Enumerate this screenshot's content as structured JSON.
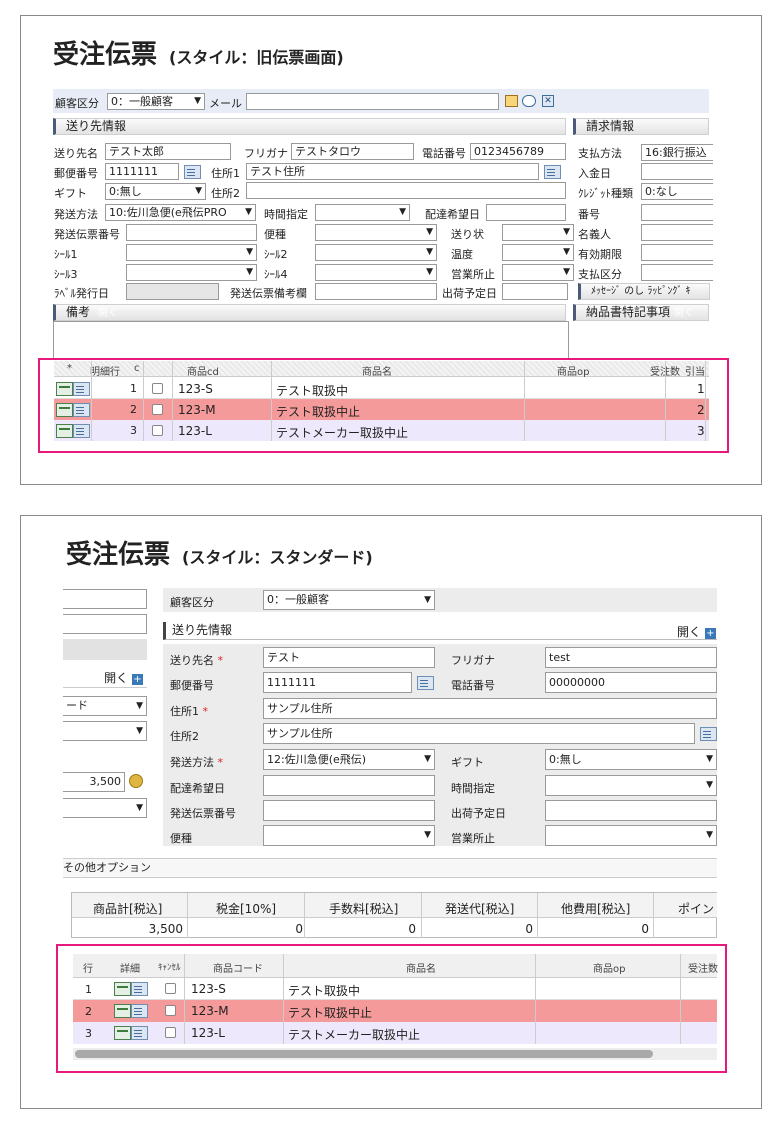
{
  "old": {
    "title": "受注伝票",
    "subtitle": "(スタイル：旧伝票画面)",
    "customer_type_label": "顧客区分",
    "customer_type_value": "0：一般顧客",
    "mail_label": "メール",
    "ship_section": "送り先情報",
    "bill_section": "請求情報",
    "ship_name_label": "送り先名",
    "ship_name_value": "テスト太郎",
    "kana_label": "フリガナ",
    "kana_value": "テストタロウ",
    "phone_label": "電話番号",
    "phone_value": "0123456789",
    "payment_label": "支払方法",
    "payment_value": "16:銀行振込",
    "zip_label": "郵便番号",
    "zip_value": "1111111",
    "addr1_label": "住所1",
    "addr1_value": "テスト住所",
    "deposit_label": "入金日",
    "gift_label": "ギフト",
    "gift_value": "0:無し",
    "addr2_label": "住所2",
    "credit_label": "ｸﾚｼﾞｯﾄ種類",
    "credit_value": "0:なし",
    "ship_method_label": "発送方法",
    "ship_method_value": "10:佐川急便(e飛伝PRO",
    "time_label": "時間指定",
    "delivery_date_label": "配達希望日",
    "number_label": "番号",
    "slip_no_label": "発送伝票番号",
    "flight_label": "便種",
    "invoice_label": "送り状",
    "holder_label": "名義人",
    "seal1_label": "ｼｰﾙ1",
    "seal2_label": "ｼｰﾙ2",
    "temp_label": "温度",
    "expiry_label": "有効期限",
    "seal3_label": "ｼｰﾙ3",
    "seal4_label": "ｼｰﾙ4",
    "office_label": "営業所止",
    "paytype_label": "支払区分",
    "label_date_label": "ﾗﾍﾞﾙ発行日",
    "slip_note_label": "発送伝票備考欄",
    "ship_date_label": "出荷予定日",
    "msg_tab": "ﾒｯｾｰｼﾞ のし ﾗｯﾋﾟﾝｸﾞ ｷ",
    "notes_section": "備考",
    "notes_toggle": "開く",
    "delivery_note_section": "納品書特記事項",
    "delivery_note_toggle": "開く",
    "cols": [
      "*",
      "明細行",
      "c",
      "商品cd",
      "商品名",
      "商品op",
      "受注数",
      "引当"
    ],
    "rows": [
      {
        "no": "1",
        "code": "123-S",
        "name": "テスト取扱中",
        "qty": "1"
      },
      {
        "no": "2",
        "code": "123-M",
        "name": "テスト取扱中止",
        "qty": "2"
      },
      {
        "no": "3",
        "code": "123-L",
        "name": "テストメーカー取扱中止",
        "qty": "3"
      }
    ]
  },
  "std": {
    "title": "受注伝票",
    "subtitle": "(スタイル：スタンダード)",
    "customer_type_label": "顧客区分",
    "customer_type_value": "0：一般顧客",
    "ship_section": "送り先情報",
    "open_label": "開く",
    "ship_name_label": "送り先名",
    "ship_name_value": "テスト",
    "kana_label": "フリガナ",
    "kana_value": "test",
    "zip_label": "郵便番号",
    "zip_value": "1111111",
    "phone_label": "電話番号",
    "phone_value": "00000000",
    "addr1_label": "住所1",
    "addr1_value": "サンプル住所",
    "addr2_label": "住所2",
    "addr2_value": "サンプル住所",
    "ship_method_label": "発送方法",
    "ship_method_value": "12:佐川急便(e飛伝)",
    "gift_label": "ギフト",
    "gift_value": "0:無し",
    "delivery_date_label": "配達希望日",
    "time_label": "時間指定",
    "slip_no_label": "発送伝票番号",
    "ship_date_label": "出荷予定日",
    "flight_label": "便種",
    "office_label": "営業所止",
    "left_open_label": "開く",
    "left_select_value": "ード",
    "left_amount": "3,500",
    "other_options": "その他オプション",
    "summary_headers": [
      "商品計[税込]",
      "税金[10%]",
      "手数料[税込]",
      "発送代[税込]",
      "他費用[税込]",
      "ポイン"
    ],
    "summary_values": [
      "3,500",
      "0",
      "0",
      "0",
      "0",
      ""
    ],
    "cols": [
      "行",
      "詳細",
      "ｷｬﾝｾﾙ",
      "商品コード",
      "商品名",
      "商品op",
      "受注数"
    ],
    "rows": [
      {
        "no": "1",
        "code": "123-S",
        "name": "テスト取扱中"
      },
      {
        "no": "2",
        "code": "123-M",
        "name": "テスト取扱中止"
      },
      {
        "no": "3",
        "code": "123-L",
        "name": "テストメーカー取扱中止"
      }
    ]
  },
  "colors": {
    "highlight": "#e8197c",
    "row_stop": "#f59a9a",
    "row_maker": "#ede8fb",
    "section_bar": "#4a5a7a"
  }
}
